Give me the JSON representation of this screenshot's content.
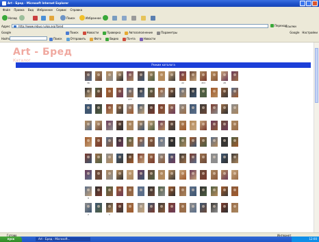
{
  "window": {
    "title": "Art - Бред - Microsoft Internet Explorer"
  },
  "menu": [
    "Файл",
    "Правка",
    "Вид",
    "Избранное",
    "Сервис",
    "Справка"
  ],
  "toolbar": {
    "back": "Назад",
    "search": "Поиск",
    "favorites": "Избранное"
  },
  "address": {
    "label": "Адрес",
    "url": "http://www.rebus.ru/go.asp?bred",
    "go": "Переход",
    "links": "Ссылки"
  },
  "googlebar": {
    "label": "Google",
    "items": [
      "Поиск",
      "Новости",
      "Проверка",
      "Автозаполнение",
      "Параметры"
    ],
    "right": [
      "Google",
      "Настройки"
    ]
  },
  "extbar": {
    "label": "Найти",
    "items": [
      "Поиск",
      "Отправить",
      "Фото",
      "Видео",
      "Почта",
      "Новости"
    ]
  },
  "page": {
    "logo": "Art - Бред",
    "sublink": "Каталог",
    "catalog_header": "Режим каталога"
  },
  "gallery_rows": [
    {
      "captions": [
        "36",
        "",
        "",
        "",
        "",
        "",
        "",
        "",
        "",
        "22",
        "",
        "453",
        "",
        "28",
        ""
      ]
    },
    {
      "captions": [
        "3",
        "",
        "",
        "",
        "277",
        "",
        "",
        "",
        "",
        "",
        "",
        "",
        "",
        "",
        ""
      ]
    },
    {
      "captions": [
        "",
        "",
        "",
        "",
        "",
        "",
        "",
        "",
        "",
        "",
        "",
        "",
        "",
        "",
        ""
      ]
    },
    {
      "captions": [
        "",
        "",
        "",
        "",
        "",
        "",
        "",
        "",
        "",
        "",
        "",
        "",
        "",
        "",
        ""
      ]
    },
    {
      "captions": [
        "",
        "",
        "",
        "",
        "",
        "",
        "",
        "",
        "",
        "",
        "",
        "",
        "",
        "",
        ""
      ]
    },
    {
      "captions": [
        "",
        "",
        "",
        "",
        "",
        "",
        "",
        "",
        "",
        "",
        "",
        "",
        "",
        "",
        ""
      ]
    },
    {
      "captions": [
        "",
        "",
        "",
        "",
        "",
        "",
        "",
        "",
        "",
        "",
        "",
        "",
        "",
        "",
        ""
      ]
    },
    {
      "captions": [
        "9",
        "",
        "",
        "",
        "",
        "",
        "",
        "",
        "",
        "",
        "",
        "",
        "",
        "",
        ""
      ]
    },
    {
      "captions": [
        "2",
        "",
        "1",
        "",
        "",
        "",
        "",
        "",
        "",
        "",
        "",
        "",
        "",
        "",
        ""
      ]
    }
  ],
  "status": {
    "left": "Готово",
    "right": "Интернет"
  },
  "taskbar": {
    "start": "пуск",
    "task": "Art - Бред - Microsoft...",
    "clock": "12:00"
  }
}
